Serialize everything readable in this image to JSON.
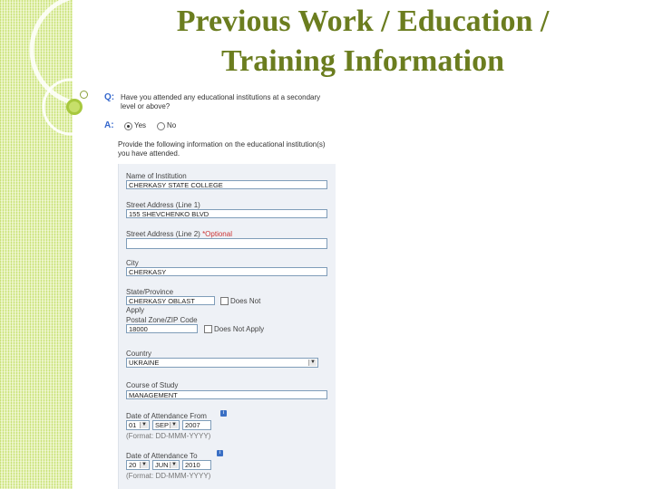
{
  "slide": {
    "title_line1": "Previous Work / Education /",
    "title_line2": "Training Information"
  },
  "form": {
    "q_label": "Q:",
    "question": "Have you attended any educational institutions at a secondary level or above?",
    "a_label": "A:",
    "answer_options": [
      "Yes",
      "No"
    ],
    "selected_answer": "Yes",
    "instructions": "Provide the following information on the educational institution(s) you have attended.",
    "fields": {
      "institution_label": "Name of Institution",
      "institution_value": "CHERKASY STATE COLLEGE",
      "street1_label": "Street Address (Line 1)",
      "street1_value": "155 SHEVCHENKO BLVD",
      "street2_label": "Street Address (Line 2)",
      "street2_optional": "*Optional",
      "street2_value": "",
      "city_label": "City",
      "city_value": "CHERKASY",
      "state_label": "State/Province",
      "state_value": "CHERKASY OBLAST",
      "state_na_label": "Does Not",
      "state_na_label2": "Apply",
      "postal_label": "Postal Zone/ZIP Code",
      "postal_value": "18000",
      "postal_na_label": "Does Not Apply",
      "country_label": "Country",
      "country_value": "UKRAINE",
      "course_label": "Course of Study",
      "course_value": "MANAGEMENT",
      "from_label": "Date of Attendance From",
      "from_day": "01",
      "from_month": "SEP",
      "from_year": "2007",
      "to_label": "Date of Attendance To",
      "to_day": "20",
      "to_month": "JUN",
      "to_year": "2010",
      "date_format": "(Format: DD-MMM-YYYY)"
    }
  },
  "colors": {
    "title": "#6b7d1f",
    "stripe": "#c9e27a",
    "qa_label": "#3366cc",
    "panel": "#eef1f6",
    "input_border": "#7f9db9"
  }
}
